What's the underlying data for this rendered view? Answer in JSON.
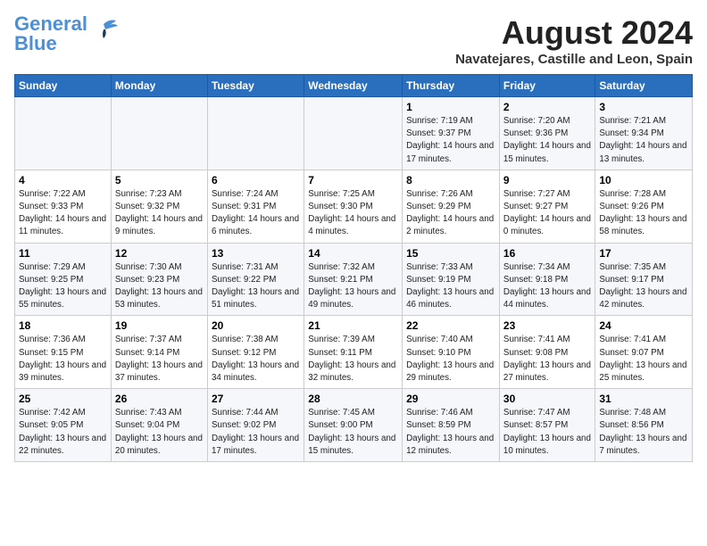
{
  "header": {
    "logo_line1": "General",
    "logo_line2": "Blue",
    "month_year": "August 2024",
    "location": "Navatejares, Castille and Leon, Spain"
  },
  "days_of_week": [
    "Sunday",
    "Monday",
    "Tuesday",
    "Wednesday",
    "Thursday",
    "Friday",
    "Saturday"
  ],
  "weeks": [
    [
      {
        "day": "",
        "info": ""
      },
      {
        "day": "",
        "info": ""
      },
      {
        "day": "",
        "info": ""
      },
      {
        "day": "",
        "info": ""
      },
      {
        "day": "1",
        "info": "Sunrise: 7:19 AM\nSunset: 9:37 PM\nDaylight: 14 hours and 17 minutes."
      },
      {
        "day": "2",
        "info": "Sunrise: 7:20 AM\nSunset: 9:36 PM\nDaylight: 14 hours and 15 minutes."
      },
      {
        "day": "3",
        "info": "Sunrise: 7:21 AM\nSunset: 9:34 PM\nDaylight: 14 hours and 13 minutes."
      }
    ],
    [
      {
        "day": "4",
        "info": "Sunrise: 7:22 AM\nSunset: 9:33 PM\nDaylight: 14 hours and 11 minutes."
      },
      {
        "day": "5",
        "info": "Sunrise: 7:23 AM\nSunset: 9:32 PM\nDaylight: 14 hours and 9 minutes."
      },
      {
        "day": "6",
        "info": "Sunrise: 7:24 AM\nSunset: 9:31 PM\nDaylight: 14 hours and 6 minutes."
      },
      {
        "day": "7",
        "info": "Sunrise: 7:25 AM\nSunset: 9:30 PM\nDaylight: 14 hours and 4 minutes."
      },
      {
        "day": "8",
        "info": "Sunrise: 7:26 AM\nSunset: 9:29 PM\nDaylight: 14 hours and 2 minutes."
      },
      {
        "day": "9",
        "info": "Sunrise: 7:27 AM\nSunset: 9:27 PM\nDaylight: 14 hours and 0 minutes."
      },
      {
        "day": "10",
        "info": "Sunrise: 7:28 AM\nSunset: 9:26 PM\nDaylight: 13 hours and 58 minutes."
      }
    ],
    [
      {
        "day": "11",
        "info": "Sunrise: 7:29 AM\nSunset: 9:25 PM\nDaylight: 13 hours and 55 minutes."
      },
      {
        "day": "12",
        "info": "Sunrise: 7:30 AM\nSunset: 9:23 PM\nDaylight: 13 hours and 53 minutes."
      },
      {
        "day": "13",
        "info": "Sunrise: 7:31 AM\nSunset: 9:22 PM\nDaylight: 13 hours and 51 minutes."
      },
      {
        "day": "14",
        "info": "Sunrise: 7:32 AM\nSunset: 9:21 PM\nDaylight: 13 hours and 49 minutes."
      },
      {
        "day": "15",
        "info": "Sunrise: 7:33 AM\nSunset: 9:19 PM\nDaylight: 13 hours and 46 minutes."
      },
      {
        "day": "16",
        "info": "Sunrise: 7:34 AM\nSunset: 9:18 PM\nDaylight: 13 hours and 44 minutes."
      },
      {
        "day": "17",
        "info": "Sunrise: 7:35 AM\nSunset: 9:17 PM\nDaylight: 13 hours and 42 minutes."
      }
    ],
    [
      {
        "day": "18",
        "info": "Sunrise: 7:36 AM\nSunset: 9:15 PM\nDaylight: 13 hours and 39 minutes."
      },
      {
        "day": "19",
        "info": "Sunrise: 7:37 AM\nSunset: 9:14 PM\nDaylight: 13 hours and 37 minutes."
      },
      {
        "day": "20",
        "info": "Sunrise: 7:38 AM\nSunset: 9:12 PM\nDaylight: 13 hours and 34 minutes."
      },
      {
        "day": "21",
        "info": "Sunrise: 7:39 AM\nSunset: 9:11 PM\nDaylight: 13 hours and 32 minutes."
      },
      {
        "day": "22",
        "info": "Sunrise: 7:40 AM\nSunset: 9:10 PM\nDaylight: 13 hours and 29 minutes."
      },
      {
        "day": "23",
        "info": "Sunrise: 7:41 AM\nSunset: 9:08 PM\nDaylight: 13 hours and 27 minutes."
      },
      {
        "day": "24",
        "info": "Sunrise: 7:41 AM\nSunset: 9:07 PM\nDaylight: 13 hours and 25 minutes."
      }
    ],
    [
      {
        "day": "25",
        "info": "Sunrise: 7:42 AM\nSunset: 9:05 PM\nDaylight: 13 hours and 22 minutes."
      },
      {
        "day": "26",
        "info": "Sunrise: 7:43 AM\nSunset: 9:04 PM\nDaylight: 13 hours and 20 minutes."
      },
      {
        "day": "27",
        "info": "Sunrise: 7:44 AM\nSunset: 9:02 PM\nDaylight: 13 hours and 17 minutes."
      },
      {
        "day": "28",
        "info": "Sunrise: 7:45 AM\nSunset: 9:00 PM\nDaylight: 13 hours and 15 minutes."
      },
      {
        "day": "29",
        "info": "Sunrise: 7:46 AM\nSunset: 8:59 PM\nDaylight: 13 hours and 12 minutes."
      },
      {
        "day": "30",
        "info": "Sunrise: 7:47 AM\nSunset: 8:57 PM\nDaylight: 13 hours and 10 minutes."
      },
      {
        "day": "31",
        "info": "Sunrise: 7:48 AM\nSunset: 8:56 PM\nDaylight: 13 hours and 7 minutes."
      }
    ]
  ]
}
